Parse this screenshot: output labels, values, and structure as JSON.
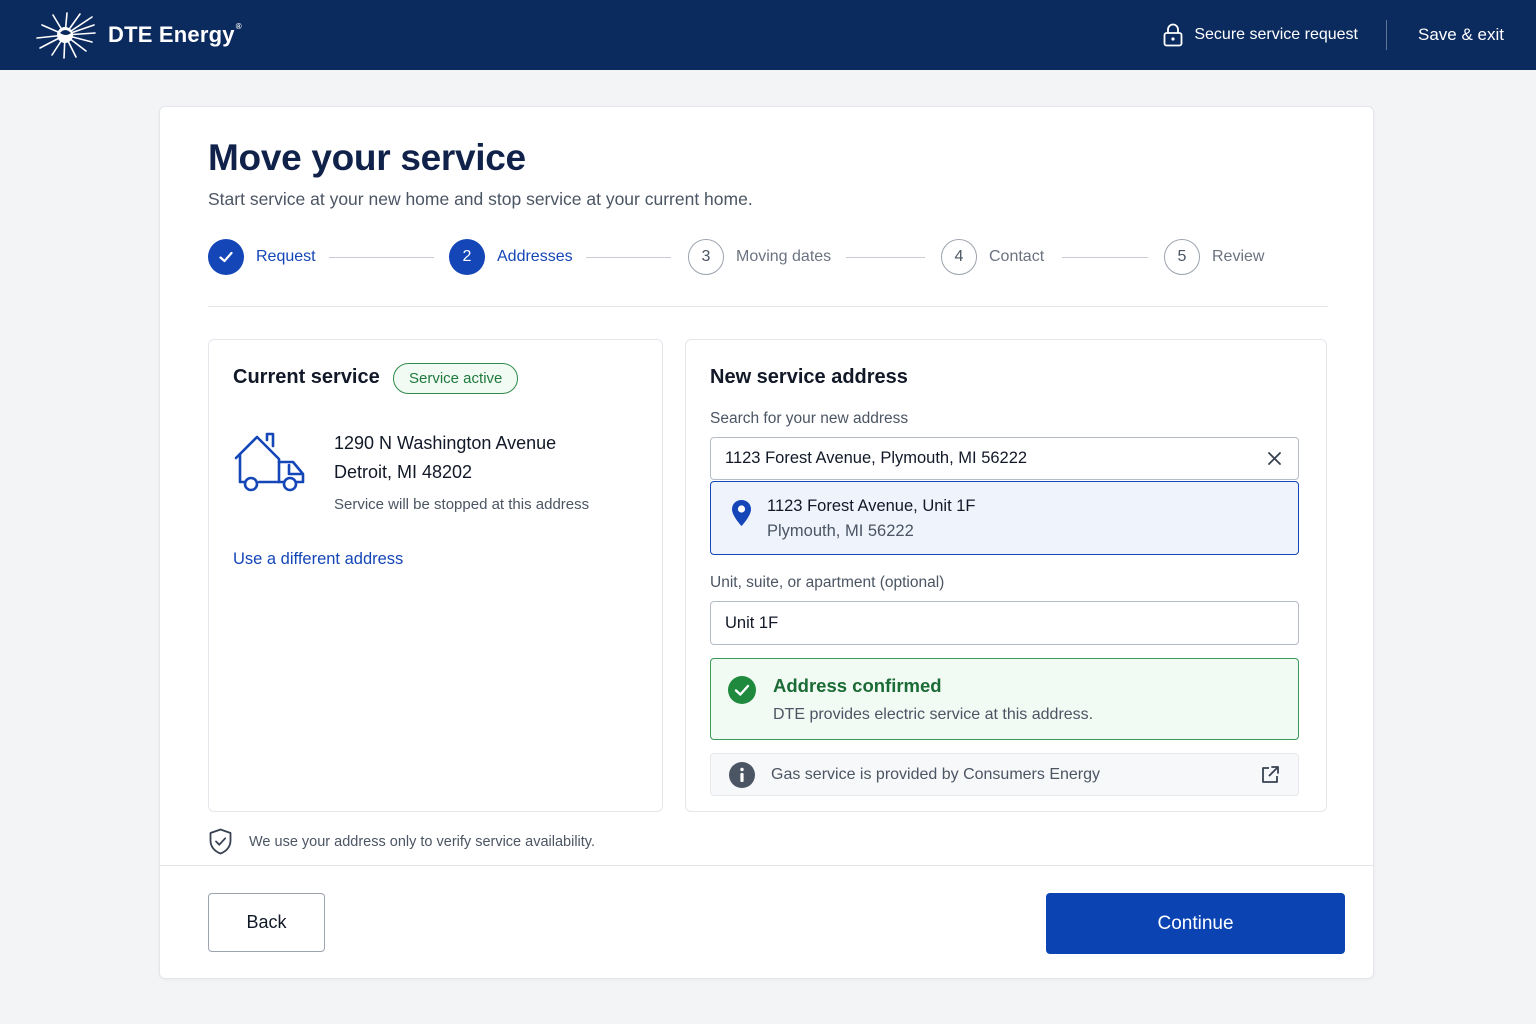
{
  "header": {
    "brand": "DTE Energy",
    "brand_mark": "®",
    "secure_label": "Secure service request",
    "save_exit": "Save & exit",
    "icons": {
      "logo": "dte-sun-logo",
      "lock": "lock-icon"
    },
    "colors": {
      "bar": "#0b2a5e"
    }
  },
  "page": {
    "title": "Move your service",
    "subtitle": "Start service at your new home and stop service at your current home."
  },
  "stepper": {
    "steps": [
      {
        "number": "1",
        "label": "Request",
        "state": "done"
      },
      {
        "number": "2",
        "label": "Addresses",
        "state": "current"
      },
      {
        "number": "3",
        "label": "Moving dates",
        "state": "todo"
      },
      {
        "number": "4",
        "label": "Contact",
        "state": "todo"
      },
      {
        "number": "5",
        "label": "Review",
        "state": "todo"
      }
    ]
  },
  "current_service": {
    "title": "Current service",
    "badge": "Service active",
    "address_line1": "1290 N Washington Avenue",
    "address_line2": "Detroit, MI 48202",
    "note": "Service will be stopped at this address",
    "link": "Use a different address",
    "icon": "moving-house-truck-icon"
  },
  "new_service": {
    "title": "New service address",
    "search_label": "Search for your new address",
    "search_value": "1123 Forest Avenue, Plymouth, MI 56222",
    "suggestion": {
      "line1": "1123 Forest Avenue, Unit 1F",
      "line2": "Plymouth, MI 56222"
    },
    "unit_label": "Unit, suite, or apartment (optional)",
    "unit_value": "Unit 1F",
    "confirmed_title": "Address confirmed",
    "confirmed_text": "DTE provides electric service at this address.",
    "gas_note": "Gas service is provided by Consumers Energy"
  },
  "privacy_note": "We use your address only to verify service availability.",
  "actions": {
    "back": "Back",
    "continue": "Continue"
  },
  "colors": {
    "primary": "#1446b8",
    "success": "#2e8a4a",
    "title": "#10214a"
  }
}
